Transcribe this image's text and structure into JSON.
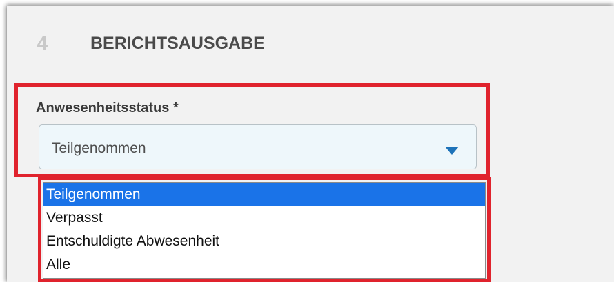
{
  "section": {
    "step_number": "4",
    "title": "BERICHTSAUSGABE"
  },
  "field": {
    "label": "Anwesenheitsstatus *",
    "selected_value": "Teilgenommen",
    "arrow_icon": "chevron-down-icon"
  },
  "options": [
    {
      "label": "Teilgenommen",
      "selected": true
    },
    {
      "label": "Verpasst",
      "selected": false
    },
    {
      "label": "Entschuldigte Abwesenheit",
      "selected": false
    },
    {
      "label": "Alle",
      "selected": false
    }
  ],
  "colors": {
    "highlight": "#e0232d",
    "option_selected_bg": "#1a73e8",
    "arrow": "#1e73b9"
  }
}
